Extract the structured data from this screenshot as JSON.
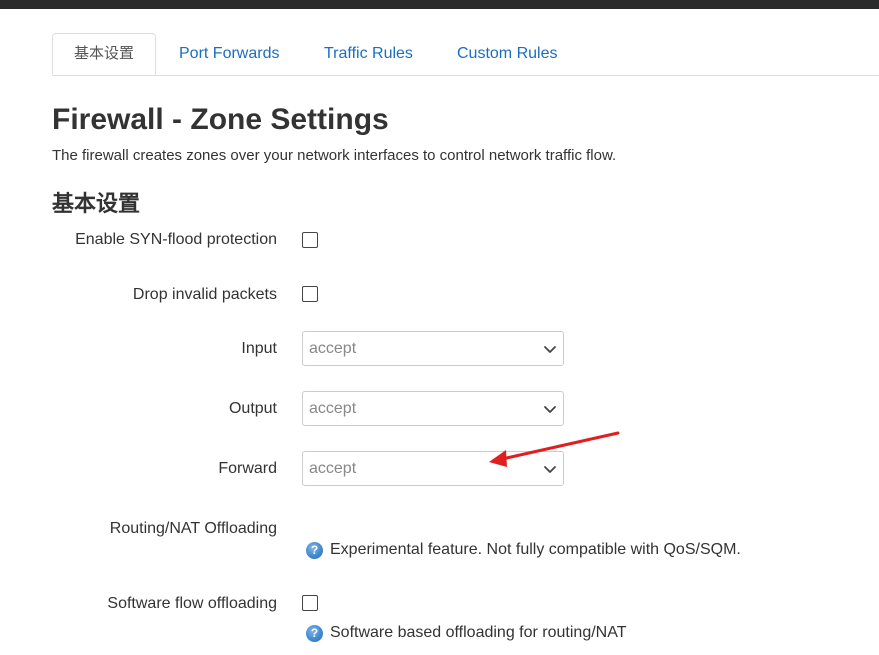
{
  "tabs": [
    {
      "label": "基本设置",
      "active": true
    },
    {
      "label": "Port Forwards",
      "active": false
    },
    {
      "label": "Traffic Rules",
      "active": false
    },
    {
      "label": "Custom Rules",
      "active": false
    }
  ],
  "page": {
    "title": "Firewall - Zone Settings",
    "description": "The firewall creates zones over your network interfaces to control network traffic flow."
  },
  "section": {
    "title": "基本设置"
  },
  "fields": {
    "syn_flood": {
      "label": "Enable SYN-flood protection",
      "checked": false
    },
    "drop_invalid": {
      "label": "Drop invalid packets",
      "checked": false
    },
    "input": {
      "label": "Input",
      "value": "accept"
    },
    "output": {
      "label": "Output",
      "value": "accept"
    },
    "forward": {
      "label": "Forward",
      "value": "accept"
    },
    "routing_nat": {
      "label": "Routing/NAT Offloading",
      "help": "Experimental feature. Not fully compatible with QoS/SQM."
    },
    "software_flow": {
      "label": "Software flow offloading",
      "checked": false,
      "help": "Software based offloading for routing/NAT"
    }
  },
  "icons": {
    "info": "info-icon",
    "chevron": "chevron-down-icon",
    "help_glyph": "?"
  },
  "colors": {
    "link": "#1a6ec2",
    "annotation_arrow": "#e02020",
    "topbar": "#2b2b2b"
  }
}
